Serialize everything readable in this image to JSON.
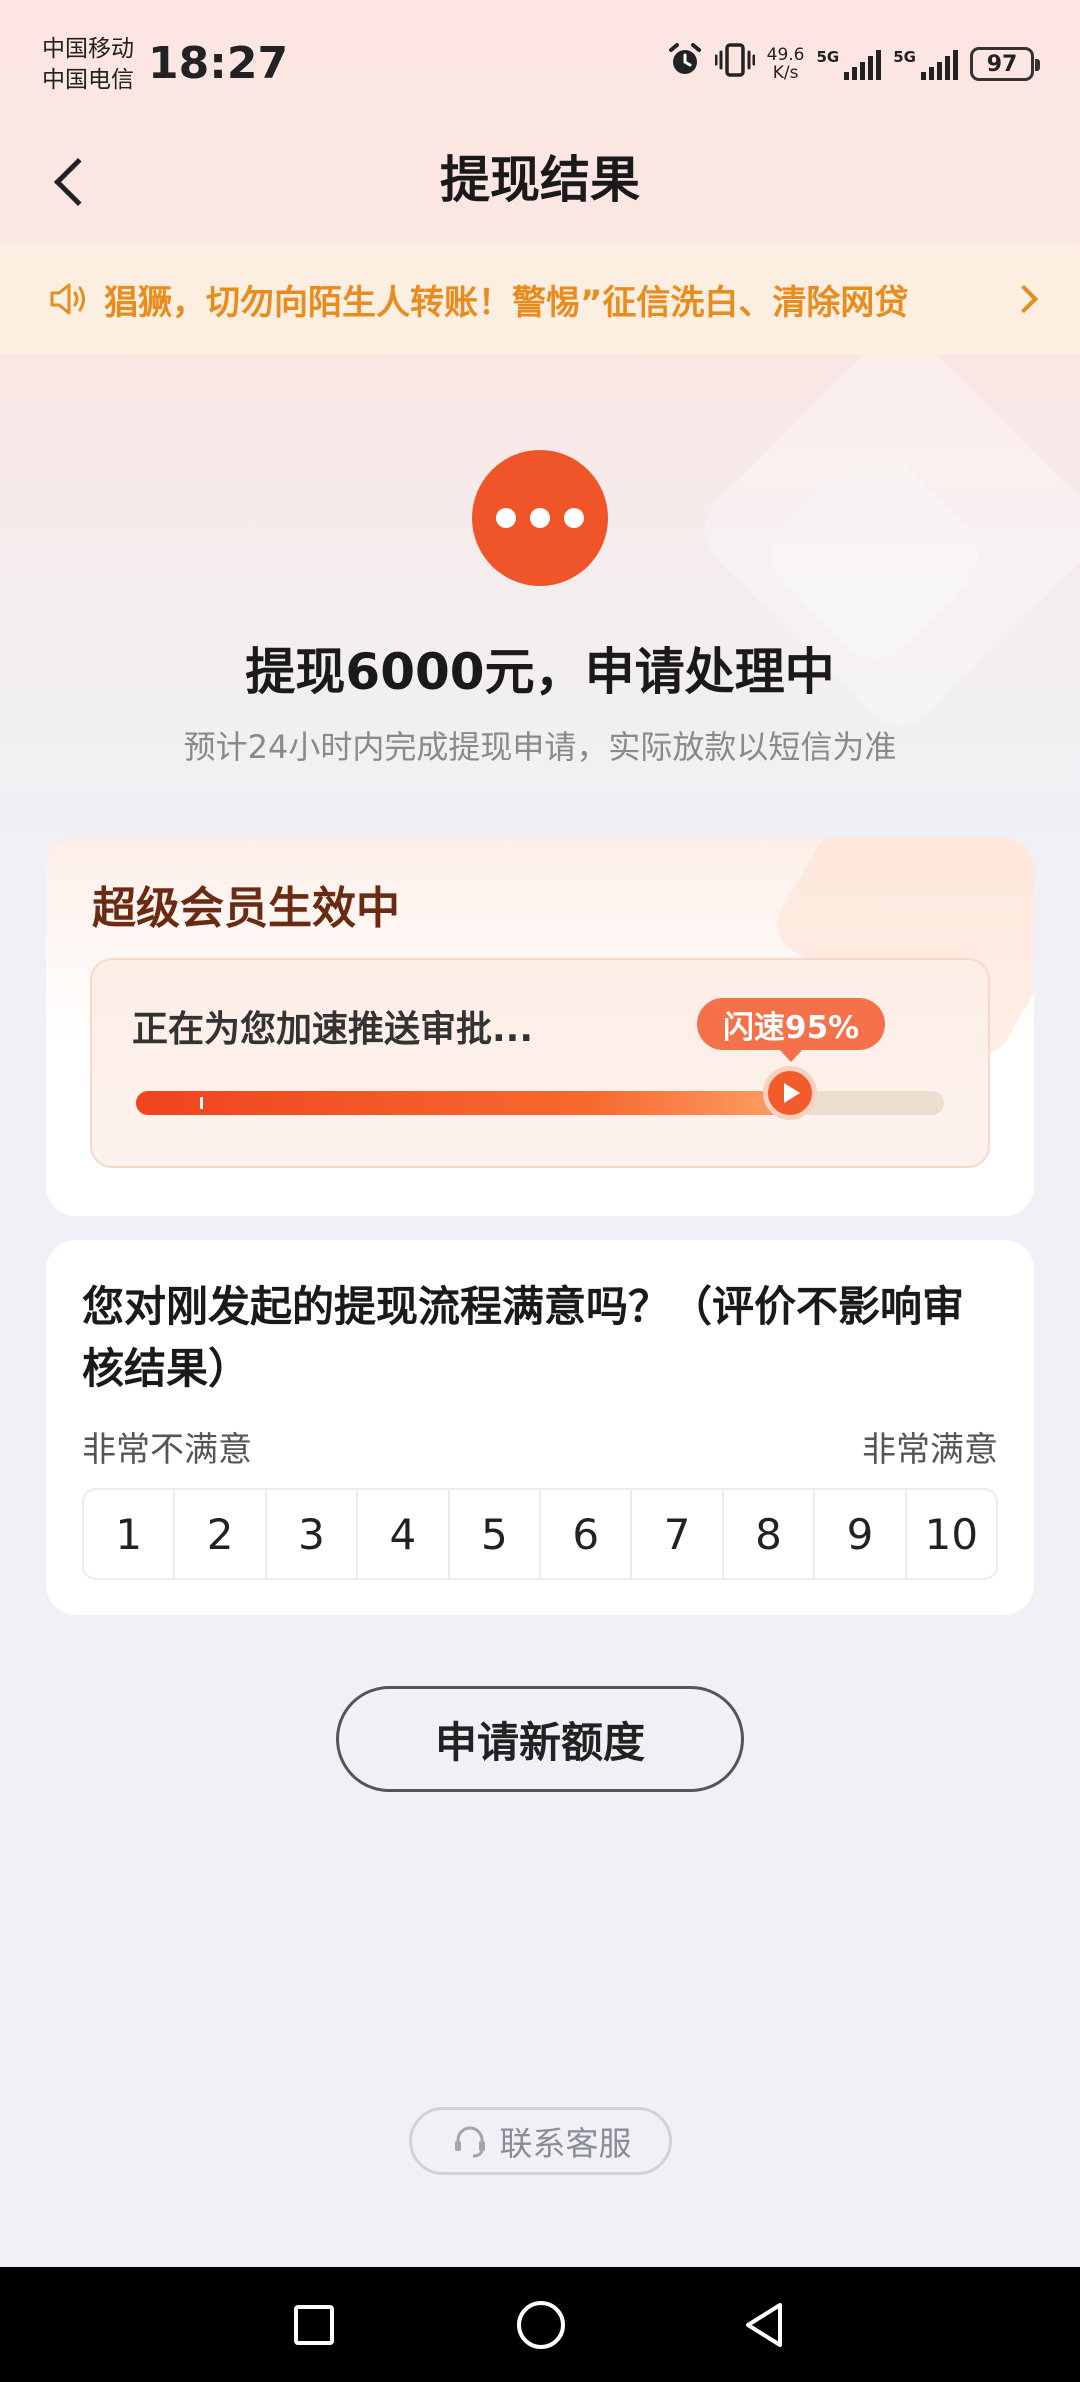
{
  "status_bar": {
    "carrier_1": "中国移动",
    "carrier_2": "中国电信",
    "time": "18:27",
    "net_speed_value": "49.6",
    "net_speed_unit": "K/s",
    "signal_1_tag": "5G",
    "signal_2_tag": "5G",
    "battery": "97",
    "icons": [
      "alarm-icon",
      "vibrate-icon",
      "signal-icon",
      "battery-icon"
    ]
  },
  "header": {
    "title": "提现结果",
    "back_icon": "back-arrow-icon"
  },
  "notice": {
    "icon": "speaker-icon",
    "text": "猖獗，切勿向陌生人转账！警惕”征信洗白、清除网贷"
  },
  "result": {
    "icon": "pending-dots-icon",
    "title": "提现6000元，申请处理中",
    "subtitle": "预计24小时内完成提现申请，实际放款以短信为准"
  },
  "member": {
    "title": "超级会员生效中",
    "progress_label": "正在为您加速推送审批...",
    "badge": "闪速95%",
    "progress_value": 0.81
  },
  "survey": {
    "question": "您对刚发起的提现流程满意吗？（评价不影响审核结果）",
    "min_label": "非常不满意",
    "max_label": "非常满意",
    "options": [
      "1",
      "2",
      "3",
      "4",
      "5",
      "6",
      "7",
      "8",
      "9",
      "10"
    ]
  },
  "actions": {
    "apply_label": "申请新额度",
    "contact_label": "联系客服",
    "contact_icon": "headset-icon"
  },
  "colors": {
    "accent": "#f0552a",
    "notice_text": "#e88c1e",
    "member_title": "#6b2a12"
  }
}
